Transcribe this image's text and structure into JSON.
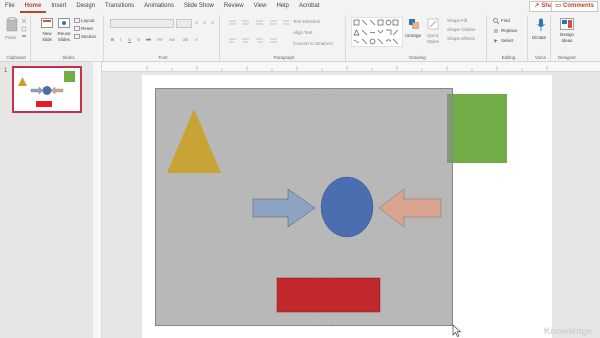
{
  "menu": {
    "tabs": [
      "File",
      "Home",
      "Insert",
      "Design",
      "Transitions",
      "Animations",
      "Slide Show",
      "Review",
      "View",
      "Help",
      "Acrobat"
    ],
    "share": "Share",
    "comments": "Comments"
  },
  "ribbon": {
    "clipboard": {
      "paste": "Paste",
      "label": "Clipboard"
    },
    "slides": {
      "new_slide": "New Slide",
      "reuse_slides": "Reuse Slides",
      "layout": "Layout",
      "reset": "Reset",
      "section": "Section",
      "label": "Slides"
    },
    "font": {
      "label": "Font"
    },
    "paragraph": {
      "text_direction": "Text Direction",
      "align_text": "Align Text",
      "convert_smartart": "Convert to SmartArt",
      "label": "Paragraph"
    },
    "drawing": {
      "arrange": "Arrange",
      "quick_styles": "Quick Styles",
      "shape_fill": "Shape Fill",
      "shape_outline": "Shape Outline",
      "shape_effects": "Shape Effects",
      "label": "Drawing"
    },
    "editing": {
      "find": "Find",
      "replace": "Replace",
      "select": "Select",
      "label": "Editing"
    },
    "voice": {
      "dictate": "Dictate",
      "label": "Voice"
    },
    "designer": {
      "design_ideas": "Design Ideas",
      "label": "Designer"
    }
  },
  "slides_panel": {
    "slide_number": "1"
  },
  "watermark": "Knowledge",
  "colors": {
    "accent": "#b7472a",
    "triangle": "#c9a227",
    "green_square": "#70ad47",
    "circle": "#4a6eb0",
    "left_arrow": "#8ea3c4",
    "right_arrow": "#d8a48f",
    "red_rect": "#c0282c"
  }
}
